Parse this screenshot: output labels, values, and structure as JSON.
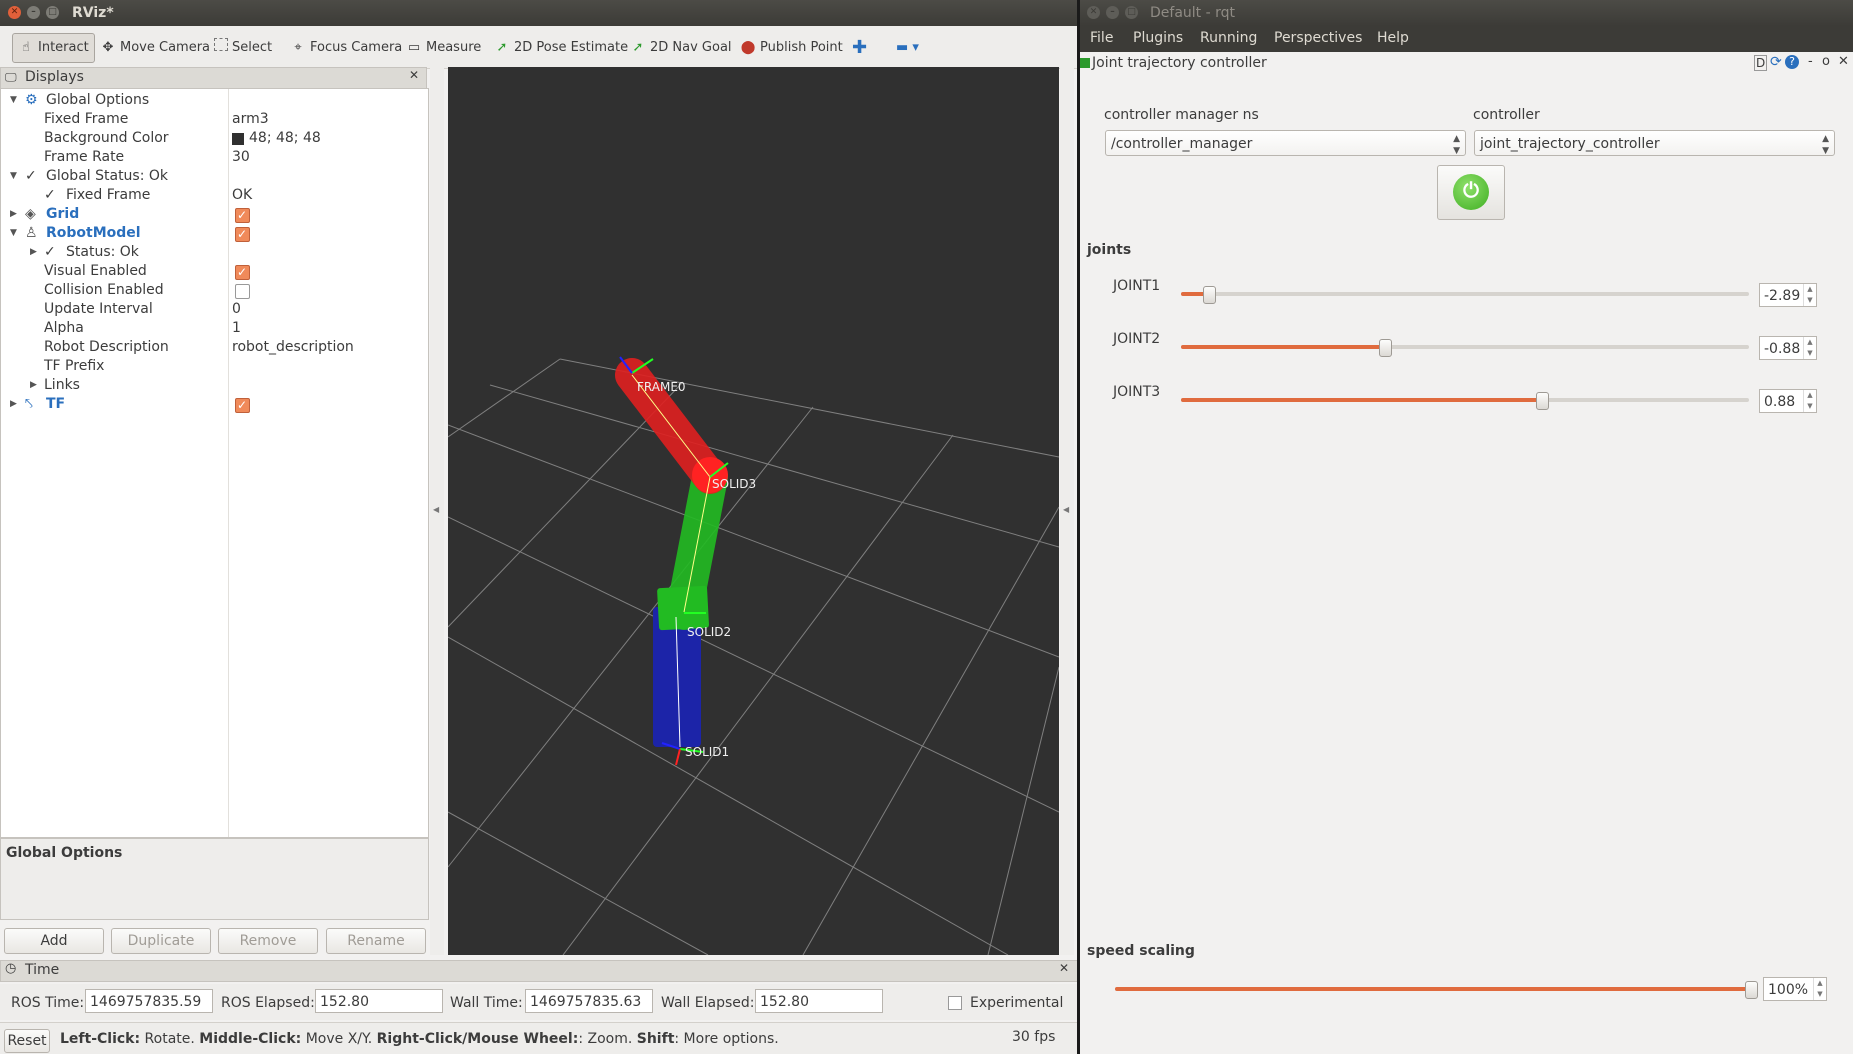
{
  "rviz": {
    "title": "RViz*",
    "toolbar": {
      "interact": "Interact",
      "move_camera": "Move Camera",
      "select": "Select",
      "focus_camera": "Focus Camera",
      "measure": "Measure",
      "pose_estimate": "2D Pose Estimate",
      "nav_goal": "2D Nav Goal",
      "publish_point": "Publish Point"
    },
    "displays": {
      "title": "Displays",
      "global_options": "Global Options",
      "fixed_frame": "Fixed Frame",
      "fixed_frame_val": "arm3",
      "bg_color": "Background Color",
      "bg_color_val": "48; 48; 48",
      "frame_rate": "Frame Rate",
      "frame_rate_val": "30",
      "global_status": "Global Status: Ok",
      "fixed_frame_status": "Fixed Frame",
      "fixed_frame_status_val": "OK",
      "grid": "Grid",
      "robot_model": "RobotModel",
      "status_ok": "Status: Ok",
      "visual_enabled": "Visual Enabled",
      "collision_enabled": "Collision Enabled",
      "update_interval": "Update Interval",
      "update_interval_val": "0",
      "alpha": "Alpha",
      "alpha_val": "1",
      "robot_description": "Robot Description",
      "robot_description_val": "robot_description",
      "tf_prefix": "TF Prefix",
      "links": "Links",
      "tf": "TF"
    },
    "description_title": "Global Options",
    "buttons": {
      "add": "Add",
      "duplicate": "Duplicate",
      "remove": "Remove",
      "rename": "Rename"
    },
    "viewport_labels": {
      "frame0": "FRAME0",
      "solid3": "SOLID3",
      "solid2": "SOLID2",
      "solid1": "SOLID1"
    },
    "time": {
      "title": "Time",
      "ros_time_label": "ROS Time:",
      "ros_time": "1469757835.59",
      "ros_elapsed_label": "ROS Elapsed:",
      "ros_elapsed": "152.80",
      "wall_time_label": "Wall Time:",
      "wall_time": "1469757835.63",
      "wall_elapsed_label": "Wall Elapsed:",
      "wall_elapsed": "152.80",
      "experimental": "Experimental"
    },
    "status": {
      "reset": "Reset",
      "left_click": "Left-Click:",
      "left_click_desc": " Rotate. ",
      "middle_click": "Middle-Click:",
      "middle_click_desc": " Move X/Y. ",
      "right_click": "Right-Click/Mouse Wheel:",
      "right_click_desc": ": Zoom. ",
      "shift": "Shift",
      "shift_desc": ": More options.",
      "fps": "30 fps"
    }
  },
  "rqt": {
    "title": "Default - rqt",
    "menu": {
      "file": "File",
      "plugins": "Plugins",
      "running": "Running",
      "perspectives": "Perspectives",
      "help": "Help"
    },
    "plugin_title": "Joint trajectory controller",
    "plugin_ctrls": "D",
    "cm_ns_label": "controller manager ns",
    "cm_ns_value": "/controller_manager",
    "controller_label": "controller",
    "controller_value": "joint_trajectory_controller",
    "joints_label": "joints",
    "joints": [
      {
        "name": "JOINT1",
        "value": "-2.89",
        "fraction": 0.05
      },
      {
        "name": "JOINT2",
        "value": "-0.88",
        "fraction": 0.36
      },
      {
        "name": "JOINT3",
        "value": "0.88",
        "fraction": 0.635
      }
    ],
    "speed_label": "speed scaling",
    "speed_value": "100%",
    "speed_fraction": 1.0
  }
}
